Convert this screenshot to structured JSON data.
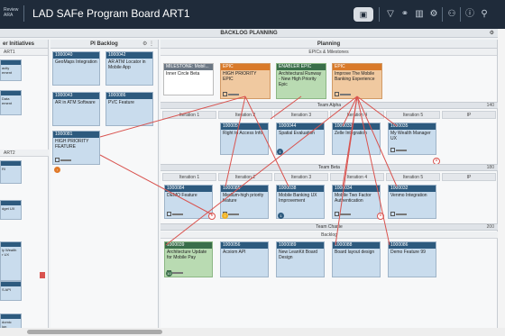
{
  "topbar": {
    "brand_line1": "Review",
    "brand_line2": "ARA",
    "title": "LAD SAFe Program Board ART1",
    "icons": [
      "board-icon",
      "filter-icon",
      "dependency-icon",
      "chart-icon",
      "settings-icon",
      "users-icon",
      "info-icon",
      "search-icon"
    ]
  },
  "board": {
    "title": "BACKLOG PLANNING"
  },
  "initiatives": {
    "header": "er Initiatives",
    "groups": [
      "ART1",
      "ART2"
    ],
    "snippets": [
      "acity",
      "ement",
      "Data",
      "ement",
      "RI",
      "dget UX",
      "ly Wealth",
      "r UX",
      "S API",
      "domic",
      "ion"
    ]
  },
  "pi_backlog": {
    "header": "PI Backlog",
    "cards": [
      {
        "id": "1000040",
        "title": "GeoMaps Integration"
      },
      {
        "id": "1000042",
        "title": "AR ATM Locator in Mobile App"
      },
      {
        "id": "1000043",
        "title": "AR in ATM Software"
      },
      {
        "id": "1000086",
        "title": "PVC Feature"
      },
      {
        "id": "1000081",
        "title": "HIGH PRIORITY FEATURE"
      }
    ]
  },
  "planning": {
    "header": "Planning",
    "epics_header": "EPICs & Milestones",
    "epics": [
      {
        "tag": "MILESTONE: Mobil...",
        "title": "Inner Circle Beta"
      },
      {
        "tag": "EPIC",
        "title": "HIGH PRIORITY EPIC"
      },
      {
        "tag": "ENABLER EPIC",
        "title": "Architectural Runway - New High Priority Epic"
      },
      {
        "tag": "EPIC",
        "title": "Improve The Mobile Banking Experience"
      }
    ],
    "teams": [
      {
        "name": "Team Alpha",
        "value": "140"
      },
      {
        "name": "Team Beta",
        "value": "180"
      },
      {
        "name": "Team Charlie",
        "value": "200"
      }
    ],
    "iterations": [
      "Iteration 1",
      "Iteration 2",
      "Iteration 3",
      "Iteration 4",
      "Iteration 5",
      "IP"
    ],
    "backlog_label": "Backlog",
    "alpha_cards": [
      {
        "id": "1000057",
        "title": "Right to Access Info"
      },
      {
        "id": "1000044",
        "title": "Spatial Evaluation"
      },
      {
        "id": "1000033",
        "title": "Zelle Integration"
      },
      {
        "id": "1000035",
        "title": "My Wealth Manager UX"
      }
    ],
    "beta_cards": [
      {
        "id": "1000084",
        "title": "DEMO Feature"
      },
      {
        "id": "1000085",
        "title": "Medium-high priority feature"
      },
      {
        "id": "1000038",
        "title": "Mobile Banking UX Improvement"
      },
      {
        "id": "1000034",
        "title": "Mobile Two Factor Authentication"
      },
      {
        "id": "1000032",
        "title": "Venmo Integration"
      }
    ],
    "backlog_cards": [
      {
        "id": "1000039",
        "title": "Architecture Update for Mobile Pay"
      },
      {
        "id": "1000056",
        "title": "Acxiom API"
      },
      {
        "id": "1000089",
        "title": "New LeanKit Board Design"
      },
      {
        "id": "1000088",
        "title": "Board layout design"
      },
      {
        "id": "1000086",
        "title": "Demo Feature 99"
      }
    ]
  },
  "colors": {
    "topbar": "#1f2b3a",
    "card_header": "#2d5a7e",
    "card_body": "#c9dced",
    "epic_orange": "#d97a2a",
    "enabler_green": "#3a6e4a",
    "link_red": "#d9534f"
  }
}
